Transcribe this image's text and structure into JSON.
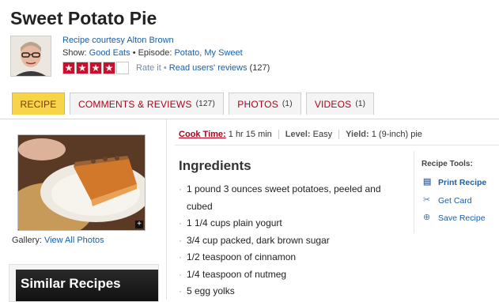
{
  "recipe": {
    "title": "Sweet Potato Pie",
    "courtesy": "Recipe courtesy Alton Brown",
    "show_label": "Show:",
    "show": "Good Eats",
    "episode_label": "• Episode:",
    "episode": "Potato, My Sweet",
    "rating": {
      "stars": 4,
      "max": 5
    },
    "rate_it": "Rate it",
    "read_reviews": "Read users' reviews",
    "reviews_count": "(127)"
  },
  "tabs": [
    {
      "label": "RECIPE",
      "count": ""
    },
    {
      "label": "COMMENTS & REVIEWS",
      "count": "(127)"
    },
    {
      "label": "PHOTOS",
      "count": "(1)"
    },
    {
      "label": "VIDEOS",
      "count": "(1)"
    }
  ],
  "gallery": {
    "label": "Gallery:",
    "link": "View All Photos"
  },
  "similar": {
    "label": "Similar Recipes"
  },
  "facts": {
    "cook_label": "Cook Time:",
    "cook_value": "1 hr 15 min",
    "level_label": "Level:",
    "level_value": "Easy",
    "yield_label": "Yield:",
    "yield_value": "1 (9-inch) pie"
  },
  "ingredients": {
    "title": "Ingredients",
    "items": [
      "1 pound 3 ounces sweet potatoes, peeled and cubed",
      "1 1/4 cups plain yogurt",
      "3/4 cup packed, dark brown sugar",
      "1/2 teaspoon of cinnamon",
      "1/4 teaspoon of nutmeg",
      "5 egg yolks"
    ]
  },
  "tools": {
    "title": "Recipe Tools:",
    "print": "Print Recipe",
    "card": "Get Card",
    "save": "Save Recipe"
  },
  "colors": {
    "accent_red": "#b3001b",
    "tab_active": "#f8d44a",
    "link_blue": "#1a5fa6"
  }
}
